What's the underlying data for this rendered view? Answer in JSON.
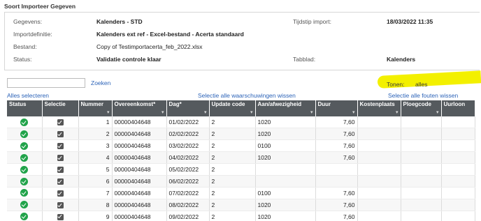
{
  "title": "Soort Importeer Gegeven",
  "info": {
    "gegevens_label": "Gegevens:",
    "gegevens_value": "Kalenders - STD",
    "tijdstip_label": "Tijdstip import:",
    "tijdstip_value": "18/03/2022 11:35",
    "importdefinitie_label": "Importdefinitie:",
    "importdefinitie_value": "Kalenders ext ref - Excel-bestand - Acerta standaard",
    "bestand_label": "Bestand:",
    "bestand_value": "Copy of Testimportacerta_feb_2022.xlsx",
    "status_label": "Status:",
    "status_value": "Validatie controle klaar",
    "tabblad_label": "Tabblad:",
    "tabblad_value": "Kalenders"
  },
  "search": {
    "placeholder": "",
    "button_label": "Zoeken"
  },
  "filter": {
    "label": "Tonen:",
    "value": "alles",
    "highlight_color": "#f3f000"
  },
  "links": {
    "select_all": "Alles selecteren",
    "warnings": "Selectie alle waarschuwingen wissen",
    "errors": "Selectie alle fouten wissen"
  },
  "colors": {
    "header": "#555a5e",
    "link": "#2c63b8",
    "status_ok": "#21a34a"
  },
  "columns": [
    "Status",
    "Selectie",
    "Nummer",
    "Overeenkomst*",
    "Dag*",
    "Update code",
    "Aan/afwezigheid",
    "Duur",
    "Kostenplaats",
    "Ploegcode",
    "Uurloon"
  ],
  "filter_icon": "filter-icon",
  "rows": [
    {
      "status": "ok",
      "selected": true,
      "nummer": "1",
      "overeenkomst": "00000404648",
      "dag": "01/02/2022",
      "update": "2",
      "aanaf": "1020",
      "duur": "7,60"
    },
    {
      "status": "ok",
      "selected": true,
      "nummer": "2",
      "overeenkomst": "00000404648",
      "dag": "02/02/2022",
      "update": "2",
      "aanaf": "1020",
      "duur": "7,60"
    },
    {
      "status": "ok",
      "selected": true,
      "nummer": "3",
      "overeenkomst": "00000404648",
      "dag": "03/02/2022",
      "update": "2",
      "aanaf": "0100",
      "duur": "7,60"
    },
    {
      "status": "ok",
      "selected": true,
      "nummer": "4",
      "overeenkomst": "00000404648",
      "dag": "04/02/2022",
      "update": "2",
      "aanaf": "1020",
      "duur": "7,60"
    },
    {
      "status": "ok",
      "selected": true,
      "nummer": "5",
      "overeenkomst": "00000404648",
      "dag": "05/02/2022",
      "update": "2",
      "aanaf": "",
      "duur": ""
    },
    {
      "status": "ok",
      "selected": true,
      "nummer": "6",
      "overeenkomst": "00000404648",
      "dag": "06/02/2022",
      "update": "2",
      "aanaf": "",
      "duur": ""
    },
    {
      "status": "ok",
      "selected": true,
      "nummer": "7",
      "overeenkomst": "00000404648",
      "dag": "07/02/2022",
      "update": "2",
      "aanaf": "0100",
      "duur": "7,60"
    },
    {
      "status": "ok",
      "selected": true,
      "nummer": "8",
      "overeenkomst": "00000404648",
      "dag": "08/02/2022",
      "update": "2",
      "aanaf": "1020",
      "duur": "7,60"
    },
    {
      "status": "ok",
      "selected": true,
      "nummer": "9",
      "overeenkomst": "00000404648",
      "dag": "09/02/2022",
      "update": "2",
      "aanaf": "1020",
      "duur": "7,60"
    }
  ]
}
